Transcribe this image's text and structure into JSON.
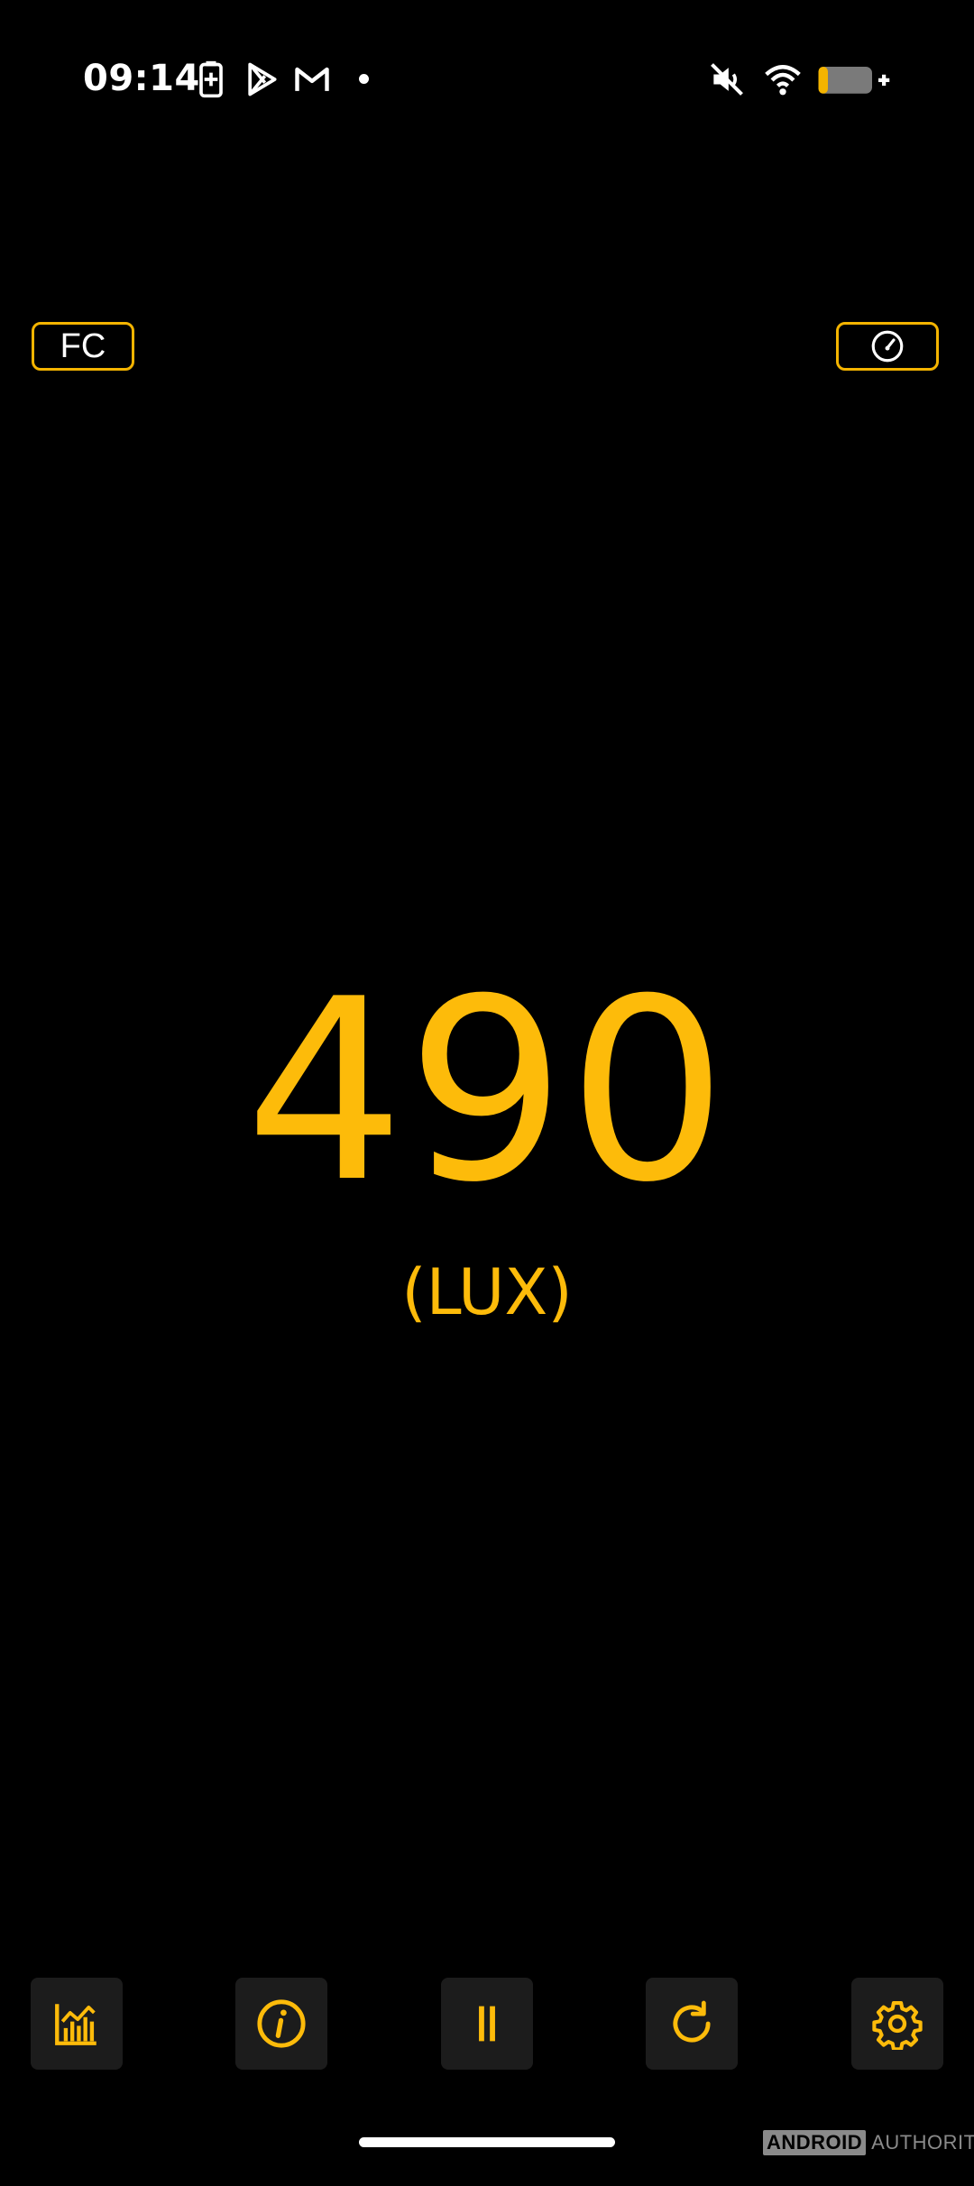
{
  "status_bar": {
    "time": "09:14",
    "icons": [
      "battery-saver-icon",
      "play-store-icon",
      "gmail-icon",
      "notification-dot",
      "mute-icon",
      "wifi-icon",
      "battery-charging-icon"
    ]
  },
  "top_bar": {
    "unit_toggle_label": "FC",
    "gauge_icon": "gauge-icon"
  },
  "reading": {
    "value": "490",
    "unit": "(LUX)"
  },
  "toolbar": {
    "items": [
      {
        "name": "chart-icon"
      },
      {
        "name": "info-icon"
      },
      {
        "name": "pause-icon"
      },
      {
        "name": "refresh-icon"
      },
      {
        "name": "settings-icon"
      }
    ]
  },
  "watermark": {
    "part1": "ANDROID",
    "part2": "AUTHORITY"
  },
  "colors": {
    "accent": "#fdbb0a",
    "background": "#000000",
    "button_bg": "#1c1c1c"
  }
}
